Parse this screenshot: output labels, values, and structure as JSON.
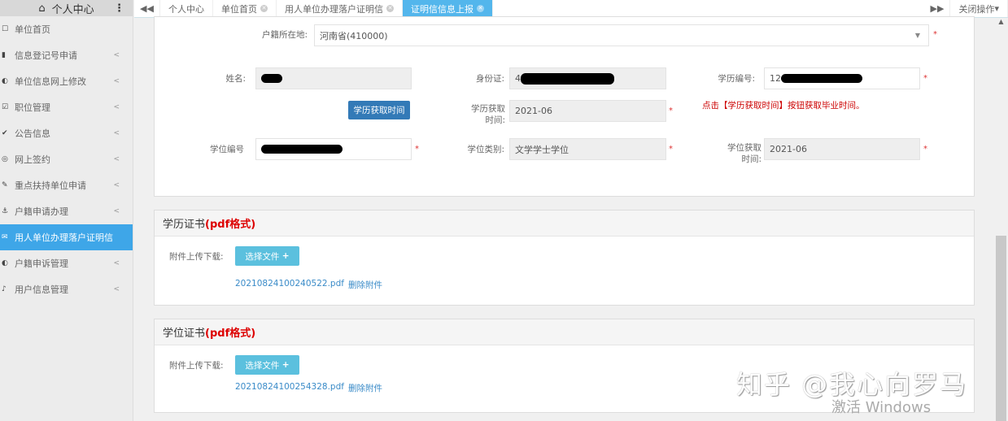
{
  "sidebar": {
    "title": "个人中心",
    "items": [
      {
        "icon": "square-icon",
        "label": "单位首页",
        "chev": false
      },
      {
        "icon": "copy-icon",
        "label": "信息登记号申请",
        "chev": true
      },
      {
        "icon": "adjust-icon",
        "label": "单位信息网上修改",
        "chev": true
      },
      {
        "icon": "check-square-icon",
        "label": "职位管理",
        "chev": true
      },
      {
        "icon": "check-icon",
        "label": "公告信息",
        "chev": true
      },
      {
        "icon": "eye-slash-icon",
        "label": "网上签约",
        "chev": true
      },
      {
        "icon": "pencil-icon",
        "label": "重点扶持单位申请",
        "chev": true
      },
      {
        "icon": "anchor-icon",
        "label": "户籍申请办理",
        "chev": true
      },
      {
        "icon": "envelope-icon",
        "label": "用人单位办理落户证明信",
        "chev": false,
        "active": true
      },
      {
        "icon": "adjust-icon",
        "label": "户籍申诉管理",
        "chev": true
      },
      {
        "icon": "bell-icon",
        "label": "用户信息管理",
        "chev": true
      }
    ]
  },
  "tabs": {
    "items": [
      "个人中心",
      "单位首页",
      "用人单位办理落户证明信",
      "证明信信息上报"
    ],
    "close_ops": "关闭操作"
  },
  "form": {
    "hukou_label": "户籍所在地:",
    "hukou_value": "河南省(410000)",
    "name_label": "姓名:",
    "id_label": "身份证:",
    "id_prefix": "4",
    "edu_no_label": "学历编号:",
    "edu_no_prefix": "12",
    "get_time_btn": "学历获取时间",
    "edu_time_label": "学历获取时间:",
    "edu_time_value": "2021-06",
    "hint": "点击【学历获取时间】按钮获取毕业时间。",
    "degree_no_label": "学位编号",
    "degree_type_label": "学位类别:",
    "degree_type_value": "文学学士学位",
    "degree_time_label": "学位获取时间:",
    "degree_time_value": "2021-06",
    "star": "*"
  },
  "sections": [
    {
      "title": "学历证书",
      "format": "(pdf格式)",
      "upload_label": "附件上传下载:",
      "choose": "选择文件",
      "file": "20210824100240522.pdf",
      "delete": "删除附件"
    },
    {
      "title": "学位证书",
      "format": "(pdf格式)",
      "upload_label": "附件上传下载:",
      "choose": "选择文件",
      "file": "20210824100254328.pdf",
      "delete": "删除附件"
    }
  ],
  "watermark": "知乎 @我心向罗马",
  "activate": "激活 Windows"
}
